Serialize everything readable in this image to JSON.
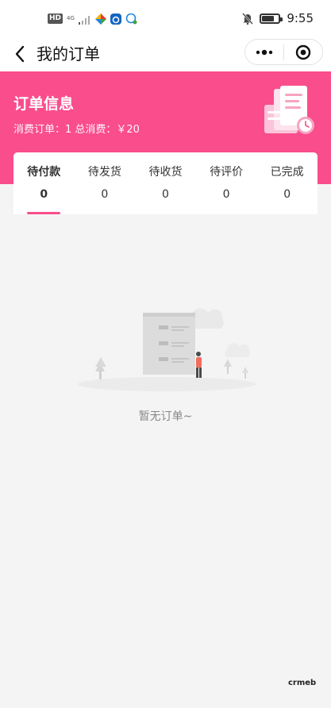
{
  "status_bar": {
    "hd_label": "HD",
    "network_label": "4G",
    "time": "9:55",
    "battery_level": 0.75
  },
  "nav": {
    "title": "我的订单",
    "icons": [
      "back-arrow-icon",
      "more-dots-icon",
      "target-close-icon"
    ]
  },
  "header": {
    "title": "订单信息",
    "summary": "消费订单：1 总消费：￥20",
    "background_color": "#fa4d8c"
  },
  "tabs": [
    {
      "label": "待付款",
      "count": "0",
      "active": true
    },
    {
      "label": "待发货",
      "count": "0",
      "active": false
    },
    {
      "label": "待收货",
      "count": "0",
      "active": false
    },
    {
      "label": "待评价",
      "count": "0",
      "active": false
    },
    {
      "label": "已完成",
      "count": "0",
      "active": false
    }
  ],
  "empty_state": {
    "text": "暂无订单~"
  },
  "watermark": "crmeb"
}
